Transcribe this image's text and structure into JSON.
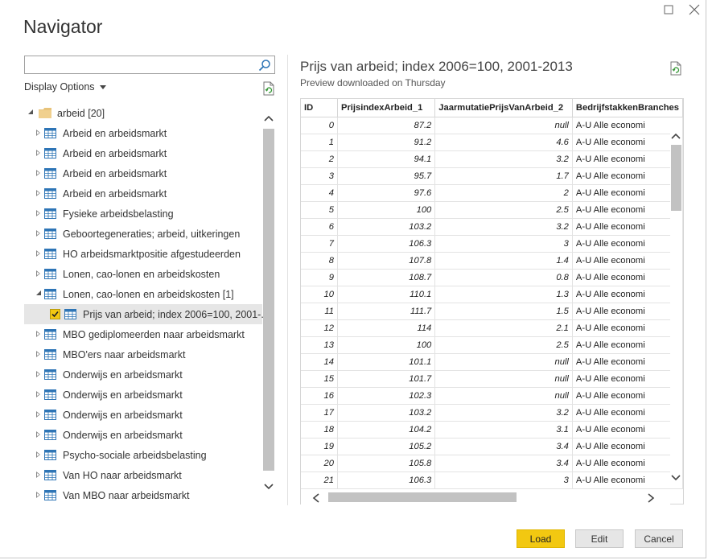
{
  "window": {
    "title": "Navigator",
    "maximize_icon": "maximize-icon",
    "close_icon": "close-icon"
  },
  "left_pane": {
    "search": {
      "placeholder": "",
      "value": ""
    },
    "display_options_label": "Display Options",
    "tree": {
      "root": {
        "label": "arbeid [20]",
        "icon": "folder-icon"
      },
      "items": [
        {
          "label": "Arbeid en arbeidsmarkt",
          "expanded": false
        },
        {
          "label": "Arbeid en arbeidsmarkt",
          "expanded": false
        },
        {
          "label": "Arbeid en arbeidsmarkt",
          "expanded": false
        },
        {
          "label": "Arbeid en arbeidsmarkt",
          "expanded": false
        },
        {
          "label": "Fysieke arbeidsbelasting",
          "expanded": false
        },
        {
          "label": "Geboortegeneraties; arbeid, uitkeringen",
          "expanded": false
        },
        {
          "label": "HO arbeidsmarktpositie afgestudeerden",
          "expanded": false
        },
        {
          "label": "Lonen, cao-lonen en arbeidskosten",
          "expanded": false
        },
        {
          "label": "Lonen, cao-lonen en arbeidskosten [1]",
          "expanded": true
        },
        {
          "label": "Prijs van arbeid; index 2006=100, 2001-...",
          "child": true,
          "checked": true
        },
        {
          "label": "MBO gediplomeerden naar arbeidsmarkt",
          "expanded": false
        },
        {
          "label": "MBO'ers naar arbeidsmarkt",
          "expanded": false
        },
        {
          "label": "Onderwijs en arbeidsmarkt",
          "expanded": false
        },
        {
          "label": "Onderwijs en arbeidsmarkt",
          "expanded": false
        },
        {
          "label": "Onderwijs en arbeidsmarkt",
          "expanded": false
        },
        {
          "label": "Onderwijs en arbeidsmarkt",
          "expanded": false
        },
        {
          "label": "Psycho-sociale arbeidsbelasting",
          "expanded": false
        },
        {
          "label": "Van HO naar arbeidsmarkt",
          "expanded": false
        },
        {
          "label": "Van MBO naar arbeidsmarkt",
          "expanded": false
        }
      ]
    }
  },
  "right_pane": {
    "title": "Prijs van arbeid; index 2006=100, 2001-2013",
    "subtitle": "Preview downloaded on Thursday",
    "table": {
      "columns": [
        "ID",
        "PrijsindexArbeid_1",
        "JaarmutatiePrijsVanArbeid_2",
        "BedrijfstakkenBranches"
      ],
      "rows": [
        [
          "0",
          "87.2",
          "null",
          "A-U Alle economi"
        ],
        [
          "1",
          "91.2",
          "4.6",
          "A-U Alle economi"
        ],
        [
          "2",
          "94.1",
          "3.2",
          "A-U Alle economi"
        ],
        [
          "3",
          "95.7",
          "1.7",
          "A-U Alle economi"
        ],
        [
          "4",
          "97.6",
          "2",
          "A-U Alle economi"
        ],
        [
          "5",
          "100",
          "2.5",
          "A-U Alle economi"
        ],
        [
          "6",
          "103.2",
          "3.2",
          "A-U Alle economi"
        ],
        [
          "7",
          "106.3",
          "3",
          "A-U Alle economi"
        ],
        [
          "8",
          "107.8",
          "1.4",
          "A-U Alle economi"
        ],
        [
          "9",
          "108.7",
          "0.8",
          "A-U Alle economi"
        ],
        [
          "10",
          "110.1",
          "1.3",
          "A-U Alle economi"
        ],
        [
          "11",
          "111.7",
          "1.5",
          "A-U Alle economi"
        ],
        [
          "12",
          "114",
          "2.1",
          "A-U Alle economi"
        ],
        [
          "13",
          "100",
          "2.5",
          "A-U Alle economi"
        ],
        [
          "14",
          "101.1",
          "null",
          "A-U Alle economi"
        ],
        [
          "15",
          "101.7",
          "null",
          "A-U Alle economi"
        ],
        [
          "16",
          "102.3",
          "null",
          "A-U Alle economi"
        ],
        [
          "17",
          "103.2",
          "3.2",
          "A-U Alle economi"
        ],
        [
          "18",
          "104.2",
          "3.1",
          "A-U Alle economi"
        ],
        [
          "19",
          "105.2",
          "3.4",
          "A-U Alle economi"
        ],
        [
          "20",
          "105.8",
          "3.4",
          "A-U Alle economi"
        ],
        [
          "21",
          "106.3",
          "3",
          "A-U Alle economi"
        ]
      ]
    }
  },
  "footer": {
    "load_label": "Load",
    "edit_label": "Edit",
    "cancel_label": "Cancel"
  },
  "colors": {
    "accent": "#f2c811",
    "table_icon": "#2e75b6",
    "folder": "#e8c37a"
  }
}
